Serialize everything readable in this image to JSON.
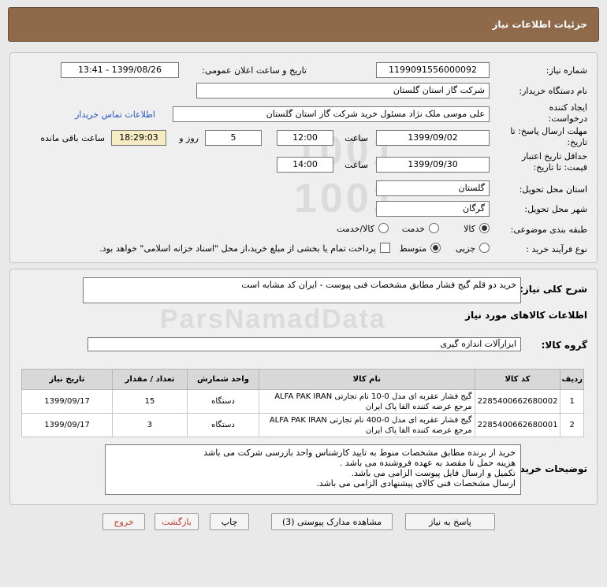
{
  "header": {
    "title": "جزئیات اطلاعات نیاز"
  },
  "form": {
    "need_number_label": "شماره نیاز:",
    "need_number": "1199091556000092",
    "announce_label": "تاریخ و ساعت اعلان عمومی:",
    "announce_value": "1399/08/26 - 13:41",
    "buyer_org_label": "نام دستگاه خریدار:",
    "buyer_org": "شرکت گاز استان گلستان",
    "requester_label": "ایجاد کننده درخواست:",
    "requester": "علی موسی ملک نژاد مسئول خرید شرکت گاز استان گلستان",
    "contact_link": "اطلاعات تماس خریدار",
    "reply_deadline_label": "مهلت ارسال پاسخ: تا تاریخ:",
    "reply_date": "1399/09/02",
    "time_label": "ساعت",
    "reply_time": "12:00",
    "days_value": "5",
    "days_label": "روز و",
    "remaining_time": "18:29:03",
    "remaining_label": "ساعت باقی مانده",
    "validity_label": "حداقل تاریخ اعتبار قیمت: تا تاریخ:",
    "validity_date": "1399/09/30",
    "validity_time": "14:00",
    "province_label": "استان محل تحویل:",
    "province": "گلستان",
    "city_label": "شهر محل تحویل:",
    "city": "گرگان",
    "category_label": "طبقه بندی موضوعی:",
    "category_options": [
      "کالا",
      "خدمت",
      "کالا/خدمت"
    ],
    "category_selected": "کالا",
    "process_label": "نوع فرآیند خرید :",
    "process_options": [
      "جزیی",
      "متوسط"
    ],
    "process_selected": "متوسط",
    "payment_note": "پرداخت تمام یا بخشی از مبلغ خرید،از محل \"اسناد خزانه اسلامی\" خواهد بود."
  },
  "details": {
    "summary_label": "شرح کلی نیاز:",
    "summary": "خرید دو قلم گیج فشار مطابق مشخصات فنی پیوست - ایران کد مشابه است",
    "goods_info_title": "اطلاعات کالاهای مورد نیاز",
    "group_label": "گروه کالا:",
    "group_value": "ابزارآلات اندازه گیری",
    "table": {
      "headers": [
        "ردیف",
        "کد کالا",
        "نام کالا",
        "واحد شمارش",
        "تعداد / مقدار",
        "تاریخ نیاز"
      ],
      "rows": [
        {
          "row": "1",
          "code": "2285400662680002",
          "name_line1": "گیج فشار عقربه ای مدل 0-10 نام تجارتی ALFA PAK IRAN",
          "name_line2": "مرجع عرضه کننده الفا پاک ایران",
          "unit": "دستگاه",
          "qty": "15",
          "date": "1399/09/17"
        },
        {
          "row": "2",
          "code": "2285400662680001",
          "name_line1": "گیج فشار عقربه ای مدل 0-400 نام تجارتی ALFA PAK IRAN",
          "name_line2": "مرجع عرضه کننده الفا پاک ایران",
          "unit": "دستگاه",
          "qty": "3",
          "date": "1399/09/17"
        }
      ]
    },
    "buyer_notes_label": "توضیحات خریدار:",
    "buyer_notes": [
      "خرید از برنده مطابق مشخصات منوط به تایید کارشناس واحد بازرسی شرکت می باشد",
      "هزینه حمل تا مقصد به عهده فروشنده می باشد .",
      "تکمیل و ارسال فایل پیوست الزامی می باشد.",
      "ارسال مشخصات فنی کالای پیشنهادی الزامی می باشد."
    ]
  },
  "buttons": {
    "reply": "پاسخ به نیاز",
    "view_docs": "مشاهده مدارک پیوستی (3)",
    "print": "چاپ",
    "back": "بازگشت",
    "exit": "خروج"
  }
}
